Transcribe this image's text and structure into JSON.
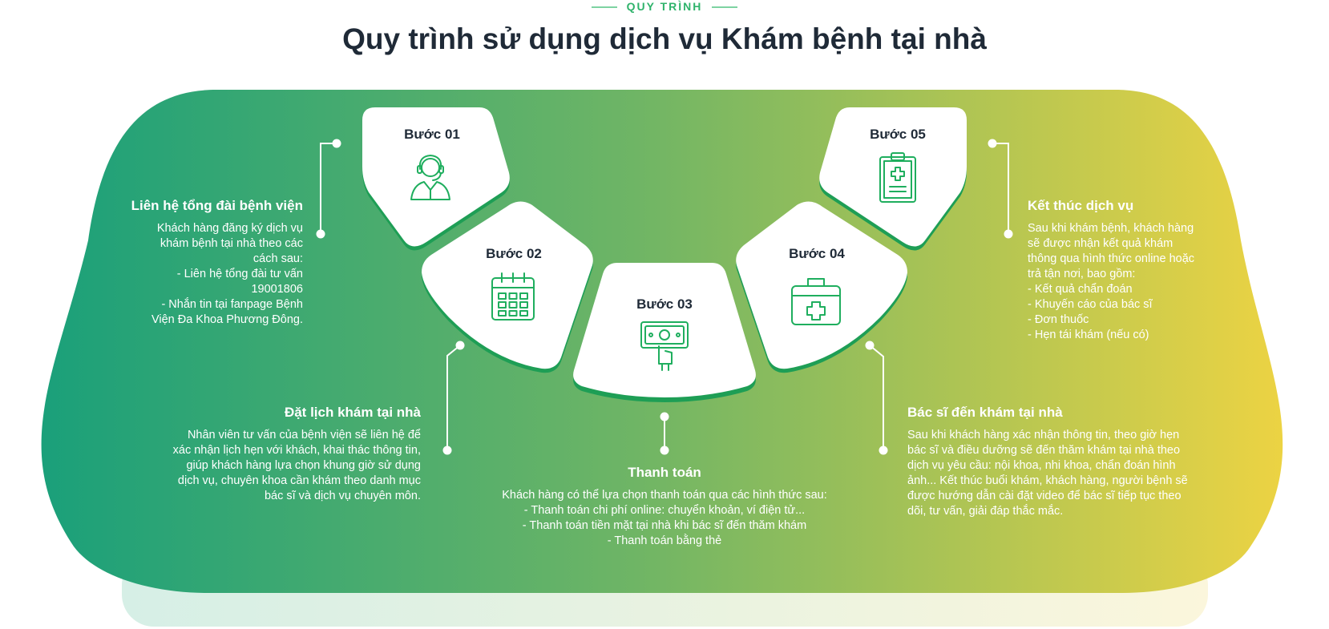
{
  "eyebrow": "QUY TRÌNH",
  "title": "Quy trình sử dụng dịch vụ Khám bệnh tại nhà",
  "colors": {
    "gradient_start": "#1aa07a",
    "gradient_mid": "#6fb565",
    "gradient_end": "#ecd343",
    "accent_green": "#1fa85a",
    "title_text": "#1f2a37"
  },
  "steps": [
    {
      "label": "Bước 01",
      "icon": "call-center-agent-icon",
      "heading": "Liên hệ tổng đài bệnh viện",
      "body": "Khách hàng đăng ký dịch vụ\nkhám bệnh tại nhà theo các\ncách sau:\n- Liên hệ tổng đài tư vấn\n19001806\n- Nhắn tin tại fanpage Bệnh\nViện Đa Khoa Phương Đông."
    },
    {
      "label": "Bước 02",
      "icon": "calendar-icon",
      "heading": "Đặt lịch khám tại nhà",
      "body": "Nhân viên tư vấn của bệnh viện sẽ liên hệ để\nxác nhận lịch hẹn với khách, khai thác thông tin,\ngiúp khách hàng lựa chọn khung giờ sử dụng\ndịch vụ, chuyên khoa cần khám theo danh mục\nbác sĩ và dịch vụ chuyên môn."
    },
    {
      "label": "Bước 03",
      "icon": "cash-payment-icon",
      "heading": "Thanh toán",
      "body": "Khách hàng có thể lựa chọn thanh toán qua các hình thức sau:\n- Thanh toán chi phí online: chuyển khoản, ví điện tử...\n- Thanh toán tiền mặt tại nhà khi bác sĩ đến thăm khám\n- Thanh toán bằng thẻ"
    },
    {
      "label": "Bước 04",
      "icon": "medical-kit-icon",
      "heading": "Bác sĩ đến khám tại nhà",
      "body": "Sau khi khách hàng xác nhận thông tin, theo giờ hẹn\nbác sĩ và điều dưỡng sẽ đến thăm khám tại nhà theo\ndịch vụ yêu cầu: nội khoa, nhi khoa, chẩn đoán hình\nảnh... Kết thúc buổi khám, khách hàng, người bệnh sẽ\nđược hướng dẫn cài đặt video để bác sĩ tiếp tục theo\ndõi, tư vấn, giải đáp thắc mắc."
    },
    {
      "label": "Bước 05",
      "icon": "medical-report-clipboard-icon",
      "heading": "Kết thúc dịch vụ",
      "body": "Sau khi khám bệnh, khách hàng\nsẽ được nhận kết quả khám\nthông qua hình thức online hoặc\ntrả tận nơi, bao gồm:\n- Kết quả chẩn đoán\n- Khuyến cáo của bác sĩ\n- Đơn thuốc\n- Hẹn tái khám (nếu có)"
    }
  ]
}
